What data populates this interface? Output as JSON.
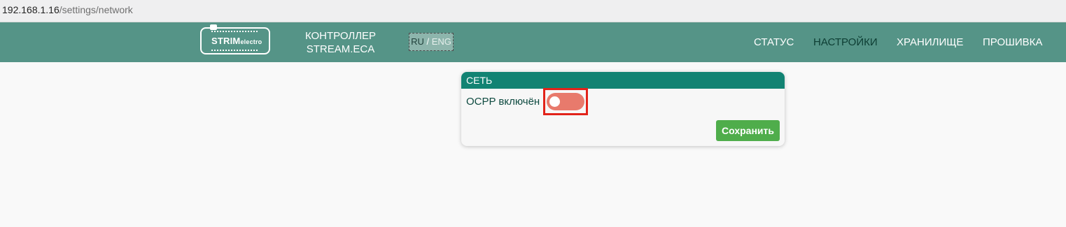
{
  "browser": {
    "url_host": "192.168.1.16",
    "url_path": "/settings/network"
  },
  "header": {
    "logo": {
      "text_main": "STRIM",
      "text_sub": "electro"
    },
    "controller_line1": "КОНТРОЛЛЕР",
    "controller_line2": "STREAM.ECA",
    "lang": {
      "ru": "RU",
      "separator": "/",
      "eng": "ENG"
    },
    "nav": [
      {
        "label": "СТАТУС",
        "active": false
      },
      {
        "label": "НАСТРОЙКИ",
        "active": true
      },
      {
        "label": "ХРАНИЛИЩЕ",
        "active": false
      },
      {
        "label": "ПРОШИВКА",
        "active": false
      }
    ]
  },
  "card": {
    "title": "СЕТЬ",
    "ocpp_label": "OCPP включён",
    "ocpp_enabled": false,
    "save_label": "Сохранить"
  },
  "colors": {
    "header_bg": "#559487",
    "card_header_bg": "#128373",
    "toggle_off": "#e87a6c",
    "save_button": "#4fad4b",
    "highlight": "#e2231a"
  }
}
